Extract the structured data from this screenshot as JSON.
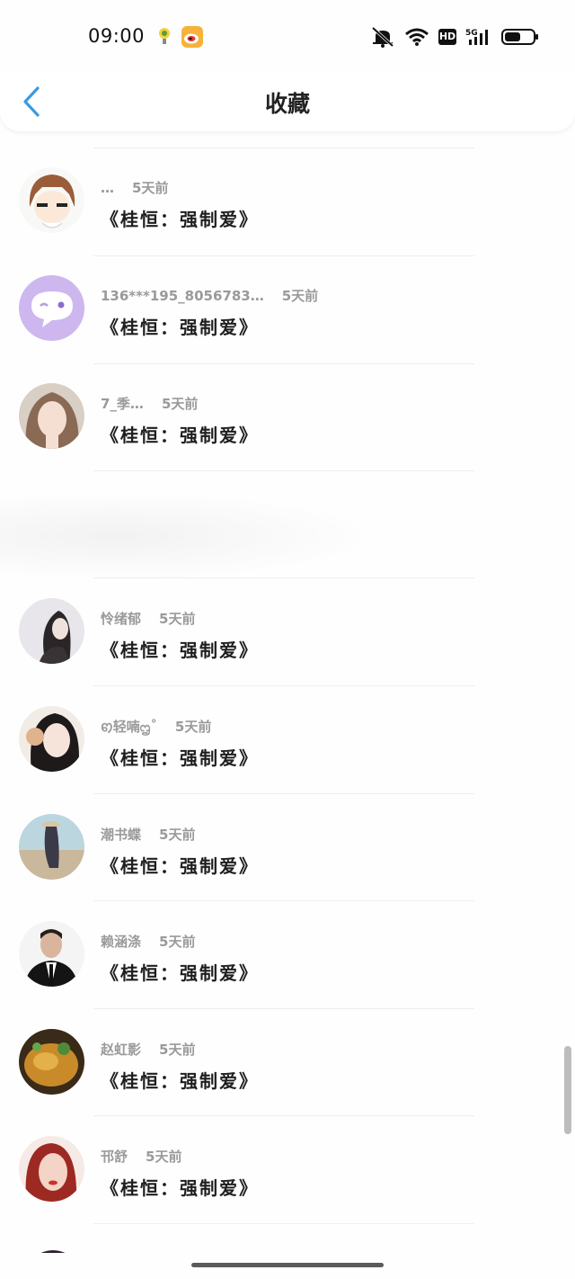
{
  "status_bar": {
    "time": "09:00",
    "network": "5G",
    "hd": "HD",
    "battery_level": 0.55
  },
  "header": {
    "title": "收藏",
    "back_icon": "chevron-left-icon",
    "accent": "#3a9bdc"
  },
  "items": [
    {
      "user": "…",
      "ago": "5天前",
      "book": "《桂恒：强制爱》"
    },
    {
      "user": "136***195_8056783…",
      "ago": "5天前",
      "book": "《桂恒：强制爱》"
    },
    {
      "user": "7_季…",
      "ago": "5天前",
      "book": "《桂恒：强制爱》"
    },
    {
      "user": "怜绪郁",
      "ago": "5天前",
      "book": "《桂恒：强制爱》"
    },
    {
      "user": "ꩅ轻喃ᦗ˚",
      "ago": "5天前",
      "book": "《桂恒：强制爱》"
    },
    {
      "user": "潮书蝶",
      "ago": "5天前",
      "book": "《桂恒：强制爱》"
    },
    {
      "user": "赖涵涤",
      "ago": "5天前",
      "book": "《桂恒：强制爱》"
    },
    {
      "user": "赵虹影",
      "ago": "5天前",
      "book": "《桂恒：强制爱》"
    },
    {
      "user": "邗舒",
      "ago": "5天前",
      "book": "《桂恒：强制爱》"
    }
  ]
}
